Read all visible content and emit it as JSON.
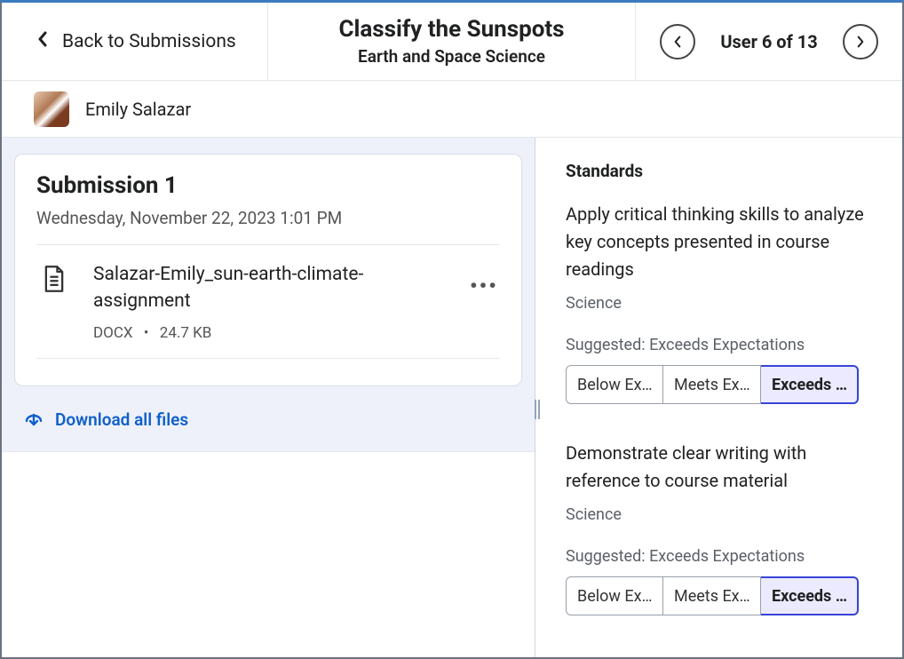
{
  "header": {
    "back_label": "Back to Submissions",
    "assignment_title": "Classify the Sunspots",
    "course_name": "Earth and Space Science",
    "user_position": "User 6 of 13"
  },
  "student": {
    "name": "Emily Salazar"
  },
  "submission": {
    "title": "Submission 1",
    "date": "Wednesday, November 22, 2023 1:01 PM",
    "file": {
      "name": "Salazar-Emily_sun-earth-climate-assignment",
      "type": "DOCX",
      "size": "24.7 KB"
    },
    "download_all_label": "Download all files"
  },
  "standards_panel": {
    "heading": "Standards",
    "items": [
      {
        "description": "Apply critical thinking skills to analyze key concepts presented in course readings",
        "subject": "Science",
        "suggested": "Suggested: Exceeds Expectations",
        "ratings": [
          "Below Ex…",
          "Meets Ex…",
          "Exceeds …"
        ],
        "selected_index": 2
      },
      {
        "description": "Demonstrate clear writing with reference to course material",
        "subject": "Science",
        "suggested": "Suggested: Exceeds Expectations",
        "ratings": [
          "Below Ex…",
          "Meets Ex…",
          "Exceeds …"
        ],
        "selected_index": 2
      }
    ]
  }
}
